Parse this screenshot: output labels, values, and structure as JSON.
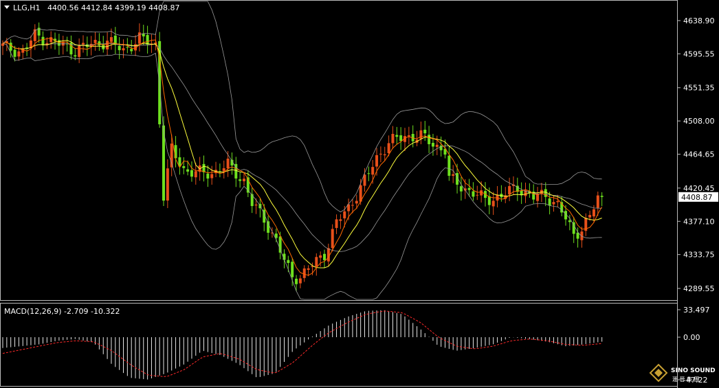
{
  "header": {
    "symbol": "LLG,H1",
    "ohlc": "4400.56 4412.84 4399.19 4408.87"
  },
  "macd_label": "MACD(12,26,9) -2.709 -10.322",
  "watermark": {
    "brand": "SINO SOUND",
    "sub": "滙 晉 集 團"
  },
  "colors": {
    "background": "#000000",
    "up_candle": "#e8501a",
    "down_candle": "#6ee01e",
    "ma_fast": "#ff6a00",
    "ma_slow": "#ffff3c",
    "bands": "#9a9a9a",
    "macd_hist": "#e8e8e8",
    "macd_signal": "#ff2a2a",
    "grid_text": "#ffffff"
  },
  "chart_data": [
    {
      "type": "candlestick",
      "title": "LLG,H1",
      "yticks": [
        4638.9,
        4595.55,
        4551.35,
        4508.0,
        4464.65,
        4420.45,
        4377.1,
        4333.75,
        4289.55
      ],
      "ylim": [
        4275,
        4662
      ],
      "current_price": 4408.87,
      "keypoints_close": [
        [
          0,
          4605
        ],
        [
          5,
          4598
        ],
        [
          8,
          4620
        ],
        [
          12,
          4612
        ],
        [
          18,
          4600
        ],
        [
          22,
          4608
        ],
        [
          26,
          4612
        ],
        [
          30,
          4600
        ],
        [
          34,
          4615
        ],
        [
          38,
          4608
        ],
        [
          40,
          4410
        ],
        [
          42,
          4470
        ],
        [
          45,
          4445
        ],
        [
          48,
          4440
        ],
        [
          52,
          4440
        ],
        [
          56,
          4450
        ],
        [
          60,
          4430
        ],
        [
          62,
          4400
        ],
        [
          65,
          4380
        ],
        [
          68,
          4352
        ],
        [
          70,
          4325
        ],
        [
          72,
          4305
        ],
        [
          74,
          4305
        ],
        [
          76,
          4315
        ],
        [
          78,
          4325
        ],
        [
          80,
          4335
        ],
        [
          83,
          4375
        ],
        [
          86,
          4395
        ],
        [
          90,
          4430
        ],
        [
          93,
          4460
        ],
        [
          96,
          4480
        ],
        [
          100,
          4488
        ],
        [
          104,
          4488
        ],
        [
          108,
          4475
        ],
        [
          110,
          4470
        ],
        [
          111,
          4432
        ],
        [
          115,
          4420
        ],
        [
          120,
          4405
        ],
        [
          124,
          4410
        ],
        [
          128,
          4422
        ],
        [
          132,
          4408
        ],
        [
          135,
          4412
        ],
        [
          138,
          4398
        ],
        [
          140,
          4380
        ],
        [
          142,
          4360
        ],
        [
          144,
          4368
        ],
        [
          146,
          4382
        ],
        [
          148,
          4408
        ]
      ],
      "indicators": [
        "bollinger_bands",
        "ma_fast",
        "ma_slow"
      ]
    },
    {
      "type": "bar",
      "title": "MACD(12,26,9) -2.709 -10.322",
      "yticks": [
        33.497,
        0.0,
        -47.22
      ],
      "ylim": [
        -47.22,
        33.497
      ],
      "series": [
        {
          "name": "histogram",
          "values": [
            -12,
            -10,
            -8,
            -4,
            -2,
            -6,
            -30,
            -45,
            -47,
            -40,
            -30,
            -15,
            -20,
            -30,
            -45,
            -40,
            -15,
            0,
            15,
            25,
            32,
            33,
            28,
            10,
            -10,
            -15,
            -12,
            -8,
            0,
            -2,
            -5,
            -10,
            -8,
            -5
          ]
        },
        {
          "name": "signal",
          "values": [
            -18,
            -14,
            -10,
            -6,
            -4,
            -5,
            -15,
            -30,
            -42,
            -44,
            -36,
            -22,
            -18,
            -24,
            -36,
            -40,
            -28,
            -10,
            6,
            18,
            28,
            32,
            30,
            18,
            0,
            -10,
            -13,
            -10,
            -4,
            -2,
            -4,
            -8,
            -9,
            -7
          ]
        }
      ]
    }
  ]
}
